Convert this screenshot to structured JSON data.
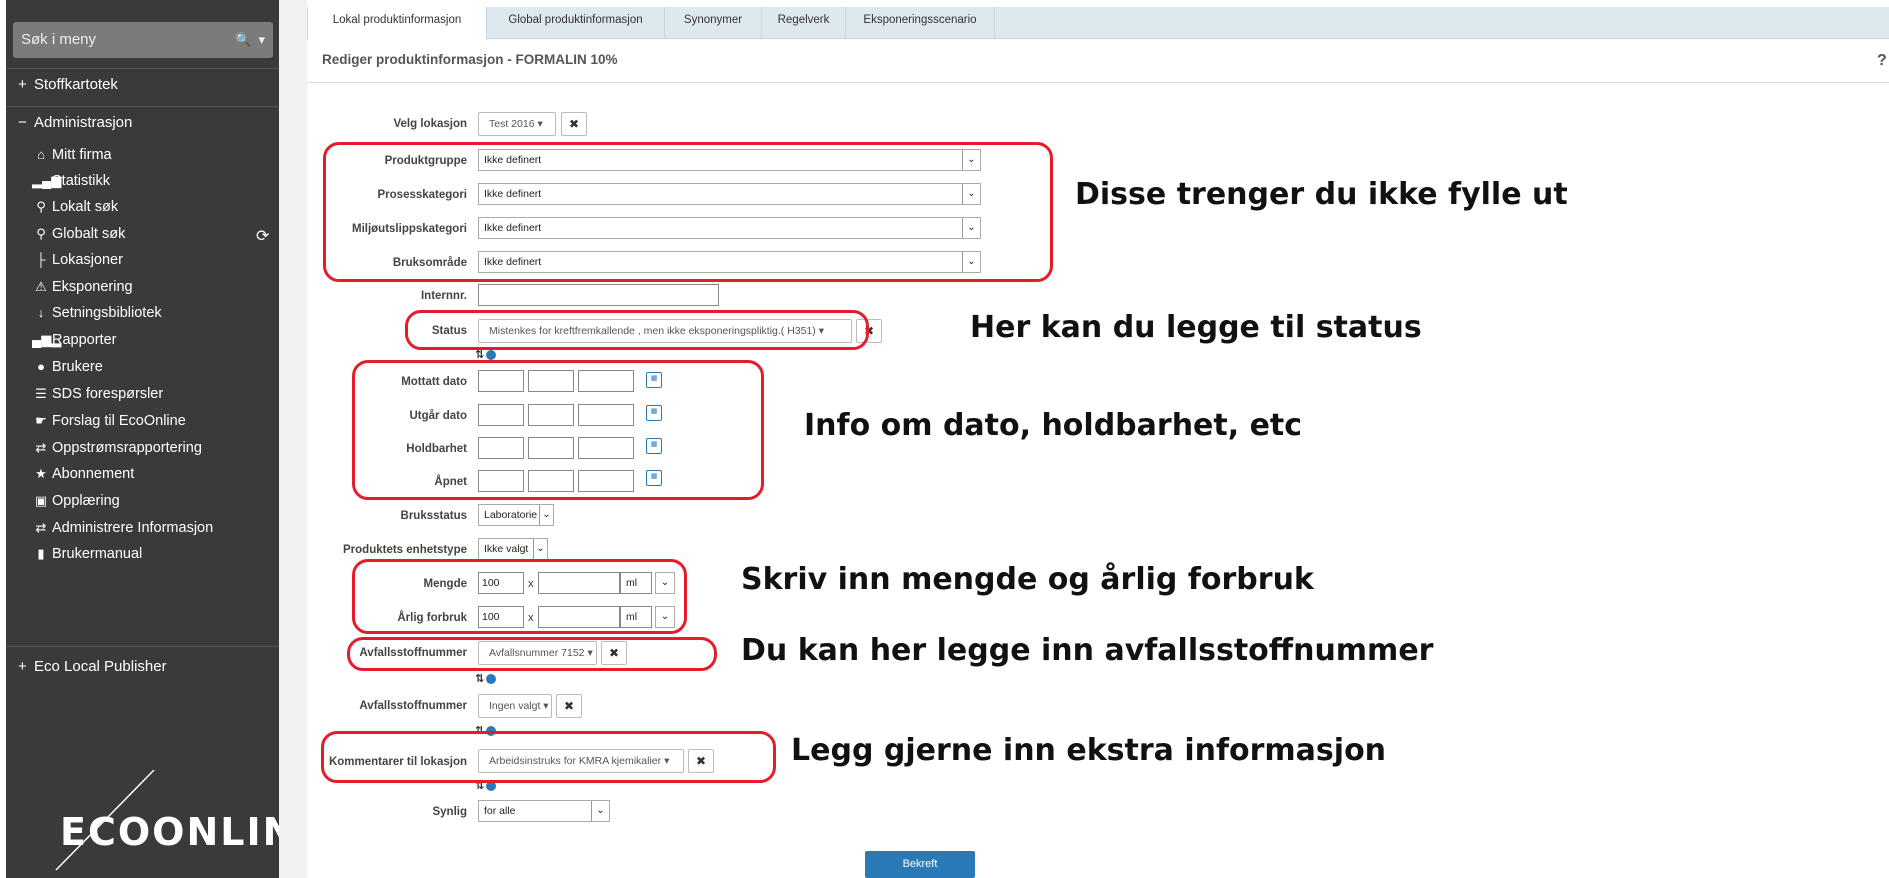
{
  "sidebar": {
    "search_placeholder": "Søk i meny",
    "stoffkartotek": "Stoffkartotek",
    "administrasjon": "Administrasjon",
    "items": [
      {
        "label": "Mitt firma"
      },
      {
        "label": "Statistikk"
      },
      {
        "label": "Lokalt søk"
      },
      {
        "label": "Globalt søk"
      },
      {
        "label": "Lokasjoner"
      },
      {
        "label": "Eksponering"
      },
      {
        "label": "Setningsbibliotek"
      },
      {
        "label": "Rapporter"
      },
      {
        "label": "Brukere"
      },
      {
        "label": "SDS forespørsler"
      },
      {
        "label": "Forslag til EcoOnline"
      },
      {
        "label": "Oppstrømsrapportering"
      },
      {
        "label": "Abonnement"
      },
      {
        "label": "Opplæring"
      },
      {
        "label": "Administrere Informasjon"
      },
      {
        "label": "Brukermanual"
      }
    ],
    "eco_local_publisher": "Eco Local Publisher",
    "logo_text": "ECOONLINE"
  },
  "tabs": [
    "Lokal produktinformasjon",
    "Global produktinformasjon",
    "Synonymer",
    "Regelverk",
    "Eksponeringsscenario"
  ],
  "page_title": "Rediger produktinformasjon - FORMALIN 10%",
  "help": "?",
  "form": {
    "velg_lokasjon": {
      "label": "Velg lokasjon",
      "value": "Test 2016"
    },
    "produktgruppe": {
      "label": "Produktgruppe",
      "value": "Ikke definert"
    },
    "prosesskategori": {
      "label": "Prosesskategori",
      "value": "Ikke definert"
    },
    "miljoutslippskategori": {
      "label": "Miljøutslippskategori",
      "value": "Ikke definert"
    },
    "bruksomrade": {
      "label": "Bruksområde",
      "value": "Ikke definert"
    },
    "internnr": {
      "label": "Internnr.",
      "value": ""
    },
    "status": {
      "label": "Status",
      "value": "Mistenkes for kreftfremkallende , men ikke eksponeringspliktig.( H351)"
    },
    "mottatt_dato": {
      "label": "Mottatt dato"
    },
    "utgar_dato": {
      "label": "Utgår dato"
    },
    "holdbarhet": {
      "label": "Holdbarhet"
    },
    "apnet": {
      "label": "Åpnet"
    },
    "bruksstatus": {
      "label": "Bruksstatus",
      "value": "Laboratorie"
    },
    "enhetstype": {
      "label": "Produktets enhetstype",
      "value": "Ikke valgt"
    },
    "mengde": {
      "label": "Mengde",
      "value": "100",
      "unit": "ml"
    },
    "arlig_forbruk": {
      "label": "Årlig forbruk",
      "value": "100",
      "unit": "ml"
    },
    "avfall1": {
      "label": "Avfallsstoffnummer",
      "value": "Avfallsnummer 7152"
    },
    "avfall2": {
      "label": "Avfallsstoffnummer",
      "value": "Ingen valgt"
    },
    "kommentarer": {
      "label": "Kommentarer til lokasjon",
      "value": "Arbeidsinstruks for KMRA kjemikalier"
    },
    "synlig": {
      "label": "Synlig",
      "value": "for alle"
    },
    "submit": "Bekreft"
  },
  "annotations": [
    "Disse trenger du ikke fylle ut",
    "Her kan du legge til status",
    "Info om dato, holdbarhet, etc",
    "Skriv inn mengde og årlig forbruk",
    "Du kan her legge inn avfallsstoffnummer",
    "Legg gjerne inn ekstra informasjon"
  ],
  "colors": {
    "annotation_red": "#e41d2c",
    "sidebar_bg": "#3a3a3a",
    "tab_bg": "#dde9ee",
    "accent_blue": "#2a7ab8"
  }
}
